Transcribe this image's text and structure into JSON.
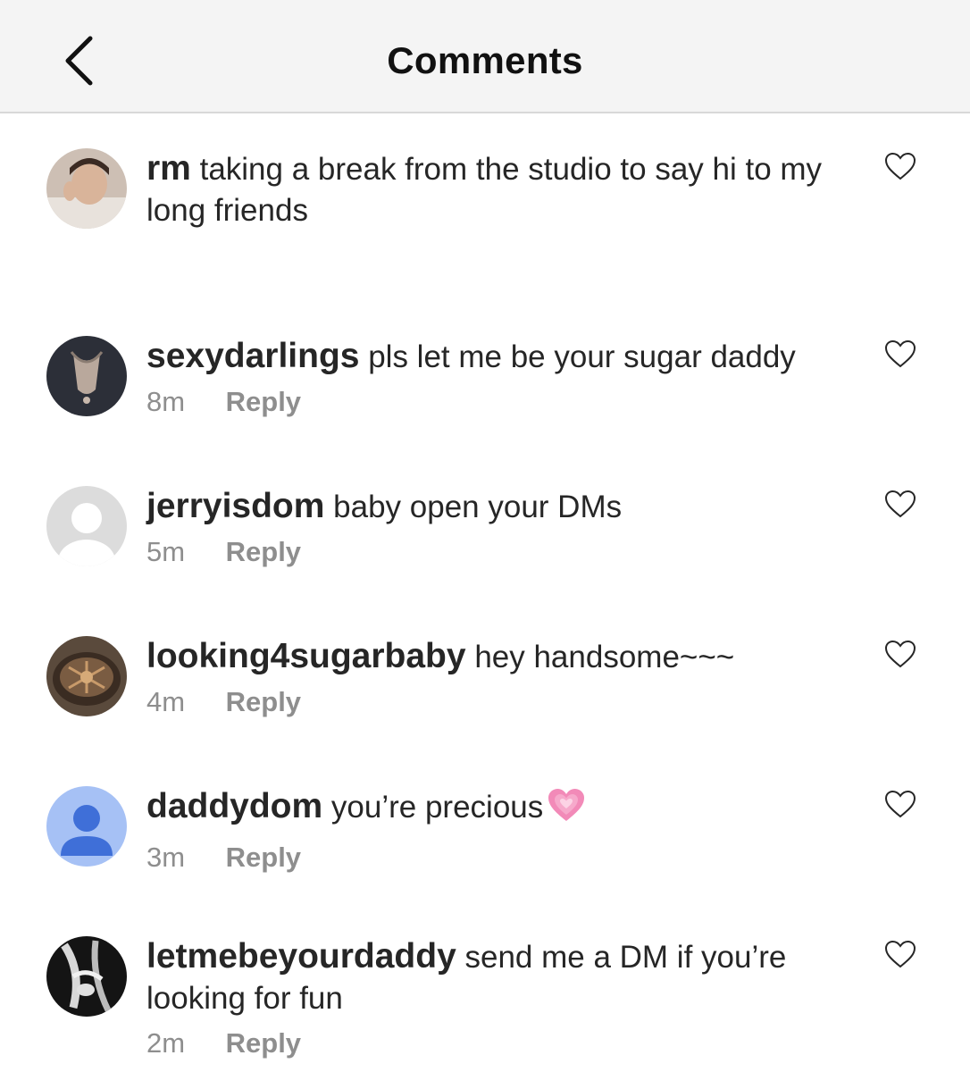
{
  "header": {
    "title": "Comments",
    "back_icon": "chevron-left-icon"
  },
  "comments": [
    {
      "username": "rm",
      "text": "taking a break from the studio to say hi to my long friends",
      "time": "",
      "reply": ""
    },
    {
      "username": "sexydarlings",
      "text": "pls let me be your sugar daddy",
      "time": "8m",
      "reply": "Reply"
    },
    {
      "username": "jerryisdom",
      "text": "baby open your DMs",
      "time": "5m",
      "reply": "Reply"
    },
    {
      "username": "looking4sugarbaby",
      "text": "hey handsome~~~",
      "time": "4m",
      "reply": "Reply"
    },
    {
      "username": "daddydom",
      "text": "you’re precious",
      "time": "3m",
      "reply": "Reply",
      "emoji": "growing-heart-emoji"
    },
    {
      "username": "letmebeyourdaddy",
      "text": "send me a DM if you’re looking for fun",
      "time": "2m",
      "reply": "Reply"
    }
  ],
  "colors": {
    "text": "#262626",
    "muted": "#8e8e8e",
    "header_bg": "#f4f4f4"
  }
}
